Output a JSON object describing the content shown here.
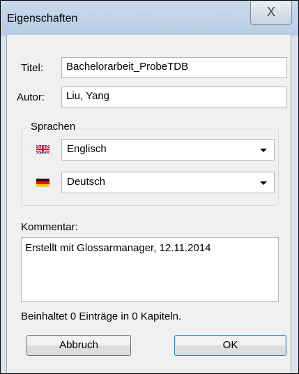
{
  "window": {
    "title": "Eigenschaften",
    "close_glyph": "X"
  },
  "fields": {
    "title_label": "Titel:",
    "title_value": "Bachelorarbeit_ProbeTDB",
    "author_label": "Autor:",
    "author_value": "Liu, Yang"
  },
  "languages": {
    "group_label": "Sprachen",
    "source": {
      "value": "Englisch",
      "icon": "uk-flag-icon"
    },
    "target": {
      "value": "Deutsch",
      "icon": "german-flag-icon"
    }
  },
  "comment": {
    "label": "Kommentar:",
    "value": "Erstellt mit Glossarmanager, 12.11.2014"
  },
  "status": "Beinhaltet 0 Einträge in 0 Kapiteln.",
  "buttons": {
    "cancel": "Abbruch",
    "ok": "OK"
  },
  "colors": {
    "ok_border": "#3c7fb1",
    "titlebar": "#b7cde4",
    "client_bg": "#f0f0f0"
  }
}
